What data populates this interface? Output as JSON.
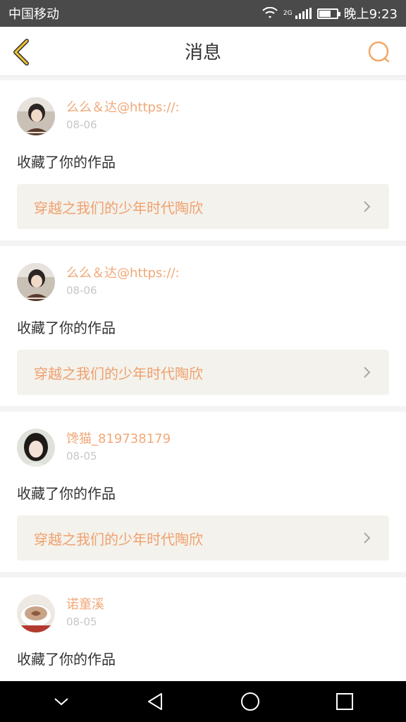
{
  "statusbar": {
    "carrier": "中国移动",
    "network": "2G",
    "time": "晚上9:23",
    "battery_level": 0.7
  },
  "header": {
    "title": "消息"
  },
  "notifications": [
    {
      "username": "么么＆达@https://:",
      "date": "08-06",
      "action": "收藏了你的作品",
      "work_title": "穿越之我们的少年时代陶欣",
      "avatar": "girl-avatar-1"
    },
    {
      "username": "么么＆达@https://:",
      "date": "08-06",
      "action": "收藏了你的作品",
      "work_title": "穿越之我们的少年时代陶欣",
      "avatar": "girl-avatar-1"
    },
    {
      "username": "馋猫_819738179",
      "date": "08-05",
      "action": "收藏了你的作品",
      "work_title": "穿越之我们的少年时代陶欣",
      "avatar": "girl-avatar-2"
    },
    {
      "username": "诺童溪",
      "date": "08-05",
      "action": "收藏了你的作品",
      "work_title": "",
      "avatar": "coffee-cup-avatar"
    }
  ],
  "colors": {
    "accent": "#f0a878",
    "back_icon": "#f2c230",
    "search_icon": "#f0a868"
  }
}
